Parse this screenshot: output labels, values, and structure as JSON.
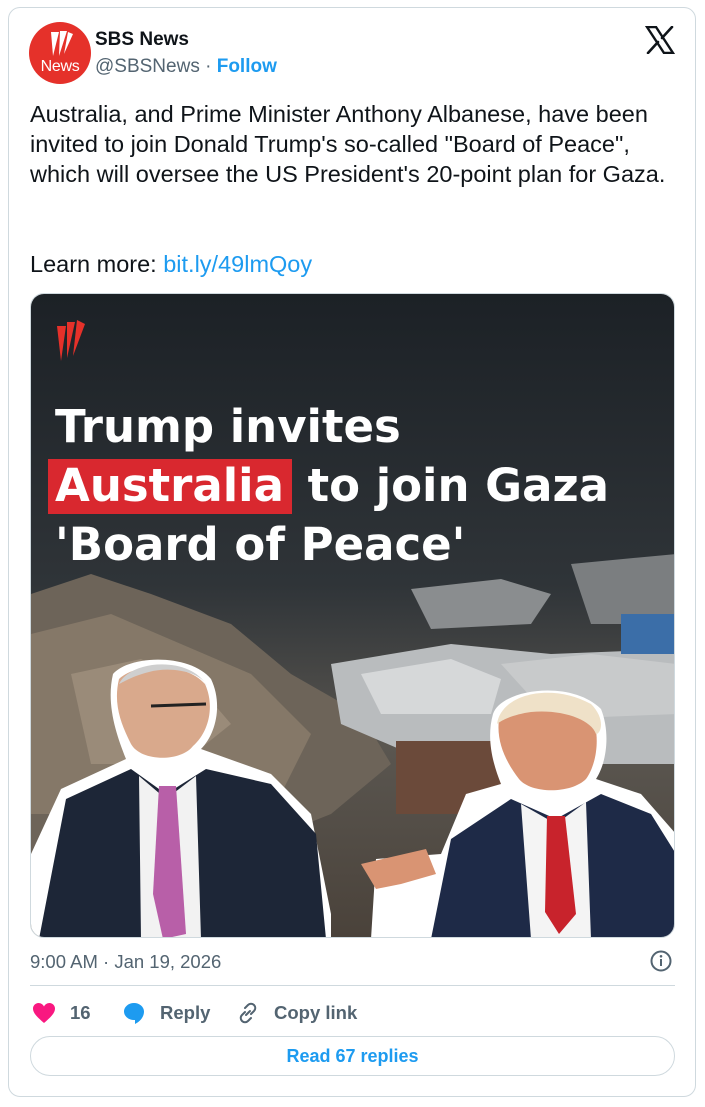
{
  "account": {
    "name": "SBS News",
    "handle": "@SBSNews",
    "separator": "·",
    "follow_label": "Follow",
    "avatar_text": "News",
    "brand_color": "#e5312a"
  },
  "tweet": {
    "text": "Australia, and Prime Minister Anthony Albanese, have been invited to join Donald Trump's so-called \"Board of Peace\", which will oversee the US President's 20-point plan for Gaza.",
    "learn_more_prefix": "Learn more: ",
    "link_text": "bit.ly/49lmQoy",
    "timestamp": "9:00 AM · Jan 19, 2026"
  },
  "media": {
    "headline_line1": "Trump invites",
    "headline_highlight": "Australia",
    "headline_line2_rest": " to join Gaza",
    "headline_line3": "'Board of Peace'",
    "highlight_color": "#d9282f"
  },
  "actions": {
    "like_count": "16",
    "reply_label": "Reply",
    "copy_label": "Copy link",
    "read_replies_label": "Read 67 replies"
  },
  "icons": [
    "x-logo-icon",
    "info-icon",
    "heart-icon",
    "reply-bubble-icon",
    "link-icon",
    "sbs-logo-icon"
  ],
  "colors": {
    "accent": "#1d9bf0",
    "like": "#f91880",
    "muted": "#536471"
  }
}
